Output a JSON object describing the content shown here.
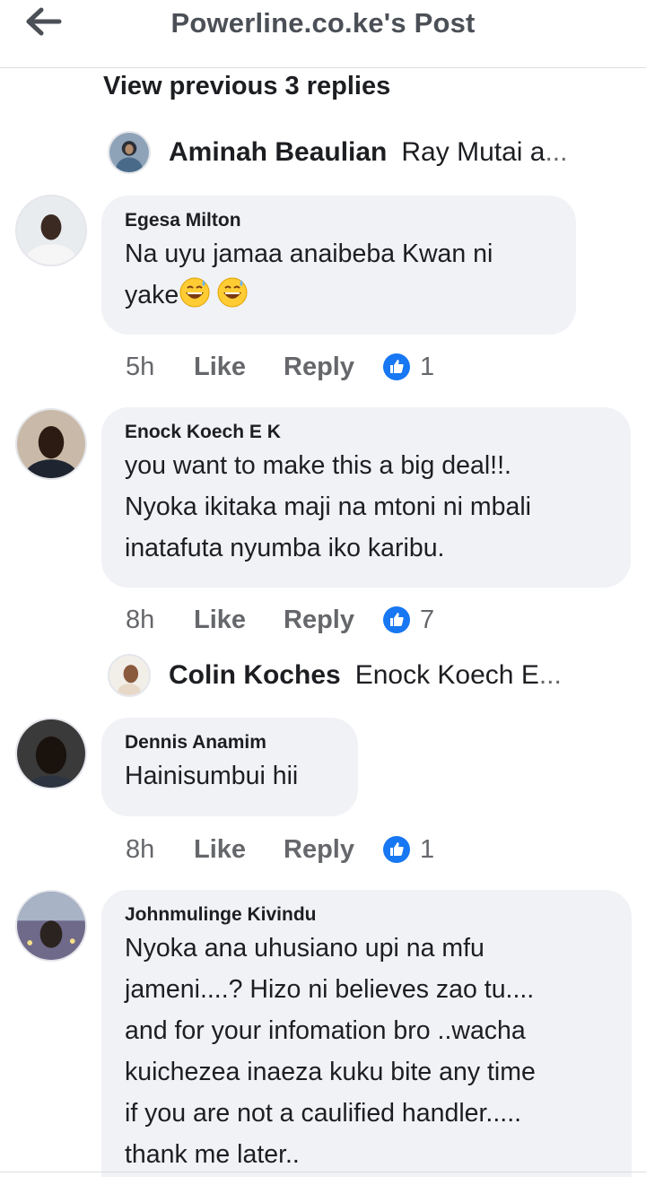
{
  "header": {
    "title": "Powerline.co.ke's Post"
  },
  "view_previous": "View previous 3 replies",
  "collapsed_replies": [
    {
      "name": "Aminah Beaulian",
      "preview": "Ray Mutai a",
      "ellipsis": "..."
    },
    {
      "name": "Colin Koches",
      "preview": "Enock Koech E ",
      "ellipsis": "..."
    }
  ],
  "comments": [
    {
      "author": "Egesa Milton",
      "lines": [
        "Na uyu jamaa anaibeba Kwan ni",
        "yake"
      ],
      "time": "5h",
      "like": "Like",
      "reply": "Reply",
      "reactions": "1"
    },
    {
      "author": "Enock Koech E K",
      "lines": [
        "you want to make this a big deal!!.",
        "Nyoka ikitaka maji na mtoni ni mbali",
        "inatafuta nyumba iko karibu."
      ],
      "time": "8h",
      "like": "Like",
      "reply": "Reply",
      "reactions": "7"
    },
    {
      "author": "Dennis Anamim",
      "lines": [
        "Hainisumbui hii"
      ],
      "time": "8h",
      "like": "Like",
      "reply": "Reply",
      "reactions": "1"
    },
    {
      "author": "Johnmulinge Kivindu",
      "lines": [
        "Nyoka ana uhusiano upi na mfu",
        "jameni....? Hizo ni believes zao tu....",
        "and for your infomation bro ..wacha",
        "kuichezea inaeza kuku bite any time",
        "if you are not a caulified handler.....",
        "thank me later.."
      ]
    }
  ],
  "icons": {
    "back": "back-arrow-icon",
    "like_reaction": "like-reaction-icon",
    "emoji": "grinning-sweat-emoji"
  },
  "colors": {
    "bubble": "#f0f2f5",
    "secondary_text": "#65676b",
    "like_blue": "#1877f2"
  }
}
